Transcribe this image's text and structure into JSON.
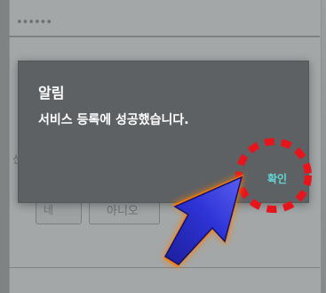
{
  "background": {
    "password_mask": "••••••",
    "side_text": "신",
    "button_left_label": "네",
    "button_right_label": "아니오"
  },
  "dialog": {
    "title": "알림",
    "message": "서비스 등록에 성공했습니다.",
    "confirm_label": "확인"
  },
  "annotation": {
    "circle_color": "#e8141c",
    "arrow_color": "#2a2ec8",
    "arrow_glow_color": "#ff7a00"
  },
  "colors": {
    "dialog_background": "#5d6163",
    "confirm_text": "#62d6d4"
  }
}
